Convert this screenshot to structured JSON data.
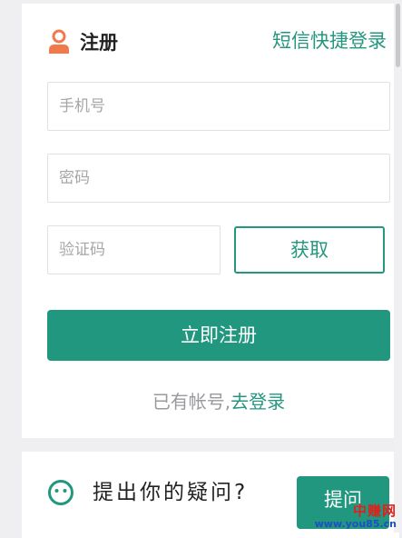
{
  "register": {
    "title": "注册",
    "sms_login_link": "短信快捷登录",
    "phone_placeholder": "手机号",
    "password_placeholder": "密码",
    "code_placeholder": "验证码",
    "get_code_label": "获取",
    "submit_label": "立即注册",
    "has_account_text": "已有帐号,",
    "login_link": "去登录"
  },
  "ask": {
    "text": "提出你的疑问?",
    "button_label": "提问"
  },
  "watermark": {
    "title": "中赚网",
    "url": "www.you85.cn"
  },
  "colors": {
    "accent": "#22977f",
    "icon_orange": "#f07a4c",
    "background": "#efeff2"
  },
  "icons": {
    "header": "user-icon",
    "ask": "smile-icon"
  }
}
